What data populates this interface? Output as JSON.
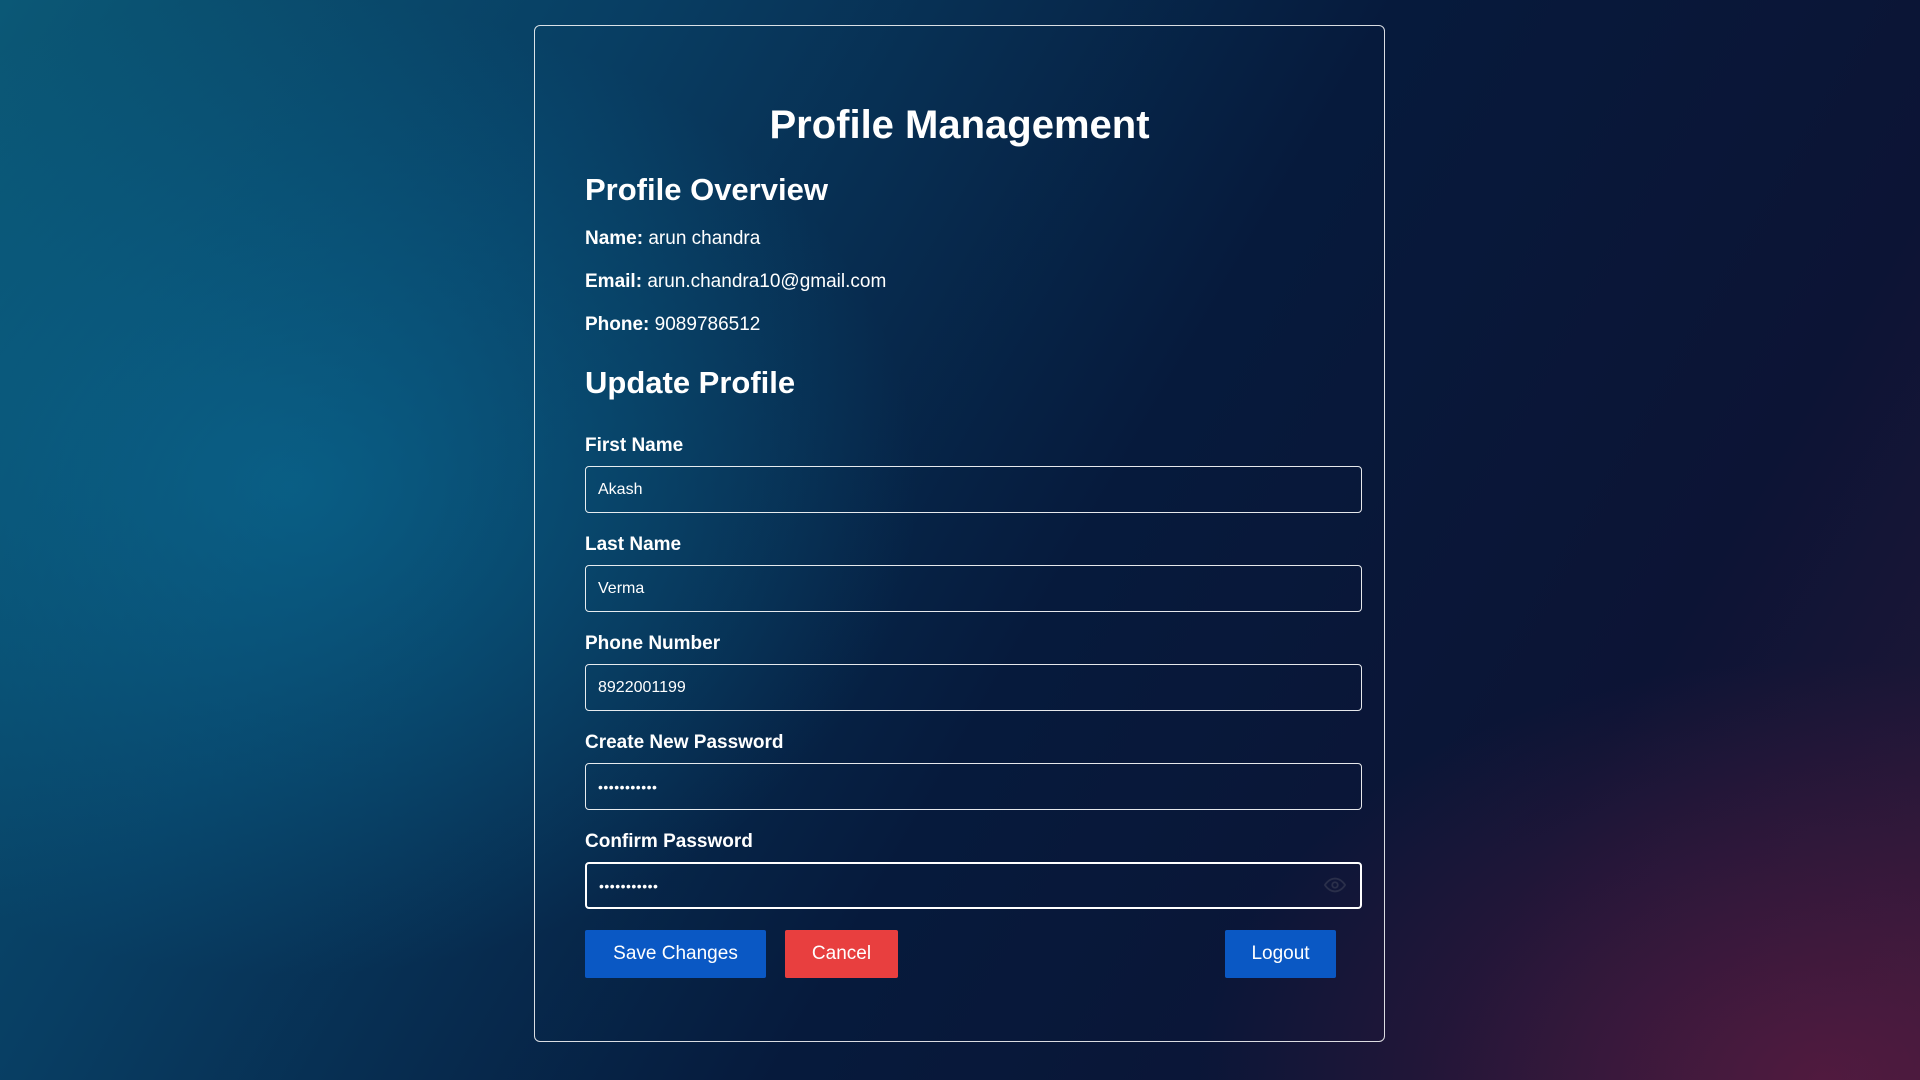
{
  "page": {
    "title": "Profile Management"
  },
  "overview": {
    "title": "Profile Overview",
    "name_label": "Name:",
    "name_value": "arun chandra",
    "email_label": "Email:",
    "email_value": "arun.chandra10@gmail.com",
    "phone_label": "Phone:",
    "phone_value": "9089786512"
  },
  "update": {
    "title": "Update Profile",
    "fields": [
      {
        "label": "First Name",
        "value": "Akash",
        "type": "text"
      },
      {
        "label": "Last Name",
        "value": "Verma",
        "type": "text"
      },
      {
        "label": "Phone Number",
        "value": "8922001199",
        "type": "tel"
      },
      {
        "label": "Create New Password",
        "value": "•••••••••••",
        "type": "password"
      },
      {
        "label": "Confirm Password",
        "value": "•••••••••••",
        "type": "password",
        "focused": true,
        "icon": "eye-icon"
      }
    ]
  },
  "buttons": {
    "save": "Save Changes",
    "cancel": "Cancel",
    "logout": "Logout"
  },
  "colors": {
    "primary": "#0a58c4",
    "danger": "#e83f3f",
    "text": "#ffffff"
  }
}
